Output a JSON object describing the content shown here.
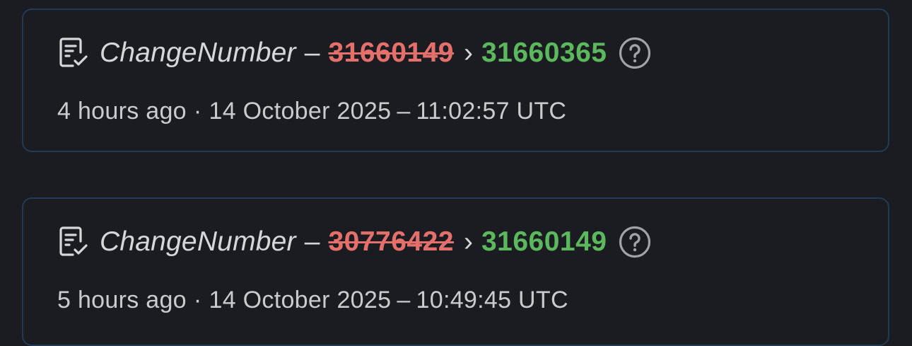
{
  "entries": [
    {
      "field": "ChangeNumber",
      "separator": "–",
      "old_value": "31660149",
      "arrow": "›",
      "new_value": "31660365",
      "relative_time": "4 hours ago",
      "dot": "·",
      "date": "14 October 2025",
      "dash": "–",
      "time": "11:02:57 UTC"
    },
    {
      "field": "ChangeNumber",
      "separator": "–",
      "old_value": "30776422",
      "arrow": "›",
      "new_value": "31660149",
      "relative_time": "5 hours ago",
      "dot": "·",
      "date": "14 October 2025",
      "dash": "–",
      "time": "10:49:45 UTC"
    }
  ],
  "icons": {
    "change": "document-check-icon",
    "help": "help-circle-icon"
  },
  "colors": {
    "background": "#1b1c21",
    "border": "#223a56",
    "old_value": "#e5706b",
    "new_value": "#5cb85c",
    "text": "#d5d7db"
  }
}
